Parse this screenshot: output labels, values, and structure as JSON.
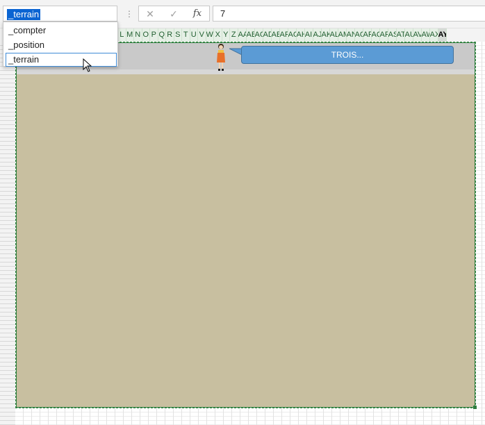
{
  "name_box": {
    "value": "_terrain"
  },
  "dropdown": {
    "items": [
      {
        "label": "_compter"
      },
      {
        "label": "_position"
      },
      {
        "label": "_terrain"
      }
    ],
    "highlighted_index": 2
  },
  "formula_bar": {
    "cancel_icon": "cancel-x-icon",
    "enter_icon": "checkmark-icon",
    "fx_label": "fx",
    "value": "7"
  },
  "columns": [
    "L",
    "M",
    "N",
    "O",
    "P",
    "Q",
    "R",
    "S",
    "T",
    "U",
    "V",
    "W",
    "X",
    "Y",
    "Z",
    "AA",
    "AB",
    "AC",
    "AD",
    "AE",
    "AF",
    "AG",
    "AH",
    "AI",
    "AJ",
    "AK",
    "AL",
    "AM",
    "AN",
    "AO",
    "AP",
    "AQ",
    "AR",
    "AS",
    "AT",
    "AU",
    "AV",
    "AW",
    "AX",
    "AY"
  ],
  "game": {
    "bubble_text": "TROIS...",
    "colors": {
      "terrain": "#c8bfa0",
      "band": "#c9c9c9",
      "bubble": "#5b9bd5",
      "selection_border": "#2e7d3e"
    }
  }
}
